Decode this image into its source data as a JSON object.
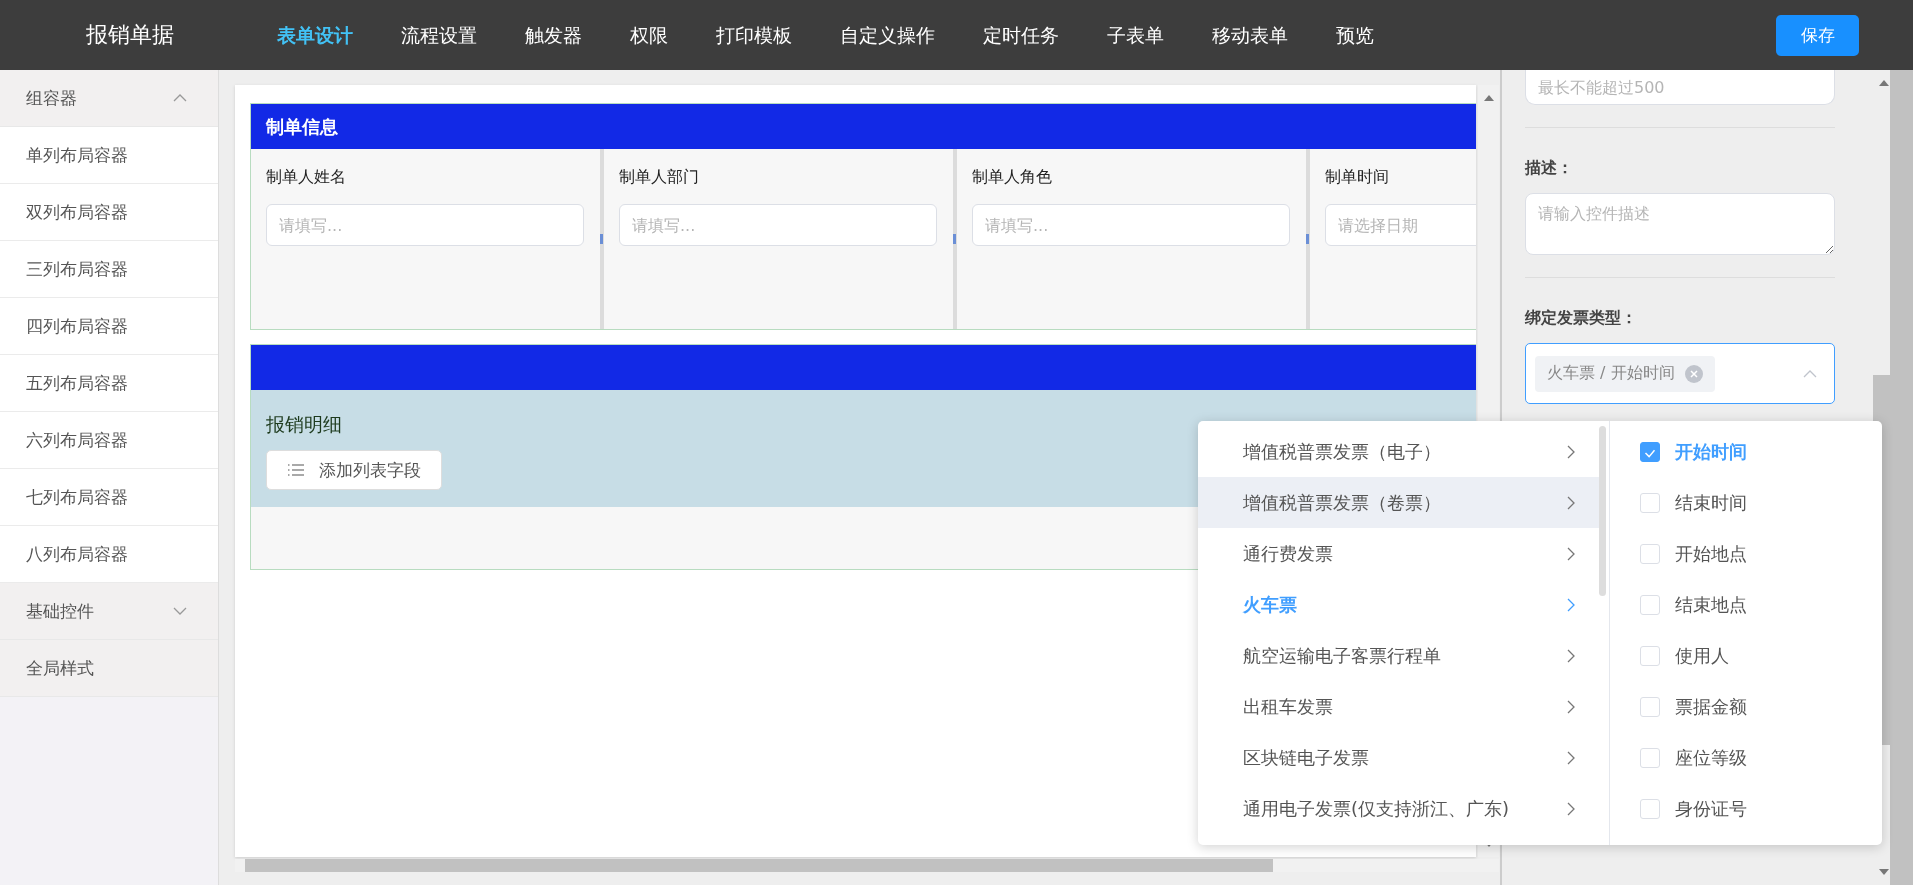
{
  "header": {
    "title": "报销单据",
    "save_button": "保存",
    "nav": [
      {
        "label": "表单设计",
        "selected": true
      },
      {
        "label": "流程设置",
        "selected": false
      },
      {
        "label": "触发器",
        "selected": false
      },
      {
        "label": "权限",
        "selected": false
      },
      {
        "label": "打印模板",
        "selected": false
      },
      {
        "label": "自定义操作",
        "selected": false
      },
      {
        "label": "定时任务",
        "selected": false
      },
      {
        "label": "子表单",
        "selected": false
      },
      {
        "label": "移动表单",
        "selected": false
      },
      {
        "label": "预览",
        "selected": false
      }
    ]
  },
  "sidebar": {
    "groups": [
      {
        "label": "组容器",
        "expanded": true,
        "items": [
          "单列布局容器",
          "双列布局容器",
          "三列布局容器",
          "四列布局容器",
          "五列布局容器",
          "六列布局容器",
          "七列布局容器",
          "八列布局容器"
        ]
      },
      {
        "label": "基础控件",
        "expanded": false
      },
      {
        "label": "全局样式"
      }
    ]
  },
  "form": {
    "sections": [
      {
        "kind": "fields",
        "title": "制单信息",
        "fields": [
          {
            "label": "制单人姓名",
            "placeholder": "请填写..."
          },
          {
            "label": "制单人部门",
            "placeholder": "请填写..."
          },
          {
            "label": "制单人角色",
            "placeholder": "请填写..."
          },
          {
            "label": "制单时间",
            "placeholder": "请选择日期"
          }
        ]
      },
      {
        "kind": "list",
        "label": "报销明细",
        "button": "添加列表字段"
      }
    ]
  },
  "properties": {
    "length_field": {
      "placeholder": "最长不能超过500"
    },
    "description": {
      "label": "描述：",
      "placeholder": "请输入控件描述"
    },
    "invoice_type": {
      "label": "绑定发票类型：",
      "tag": "火车票 / 开始时间",
      "expanded": true
    }
  },
  "cascader": {
    "options": [
      {
        "label": "增值税普票发票（电子）",
        "selected": false,
        "hovered": false
      },
      {
        "label": "增值税普票发票（卷票）",
        "selected": false,
        "hovered": true
      },
      {
        "label": "通行费发票",
        "selected": false,
        "hovered": false
      },
      {
        "label": "火车票",
        "selected": true,
        "hovered": false
      },
      {
        "label": "航空运输电子客票行程单",
        "selected": false,
        "hovered": false
      },
      {
        "label": "出租车发票",
        "selected": false,
        "hovered": false
      },
      {
        "label": "区块链电子发票",
        "selected": false,
        "hovered": false
      },
      {
        "label": "通用电子发票(仅支持浙江、广东)",
        "selected": false,
        "hovered": false
      }
    ],
    "fields": [
      {
        "label": "开始时间",
        "checked": true
      },
      {
        "label": "结束时间",
        "checked": false
      },
      {
        "label": "开始地点",
        "checked": false
      },
      {
        "label": "结束地点",
        "checked": false
      },
      {
        "label": "使用人",
        "checked": false
      },
      {
        "label": "票据金额",
        "checked": false
      },
      {
        "label": "座位等级",
        "checked": false
      },
      {
        "label": "身份证号",
        "checked": false
      }
    ]
  }
}
